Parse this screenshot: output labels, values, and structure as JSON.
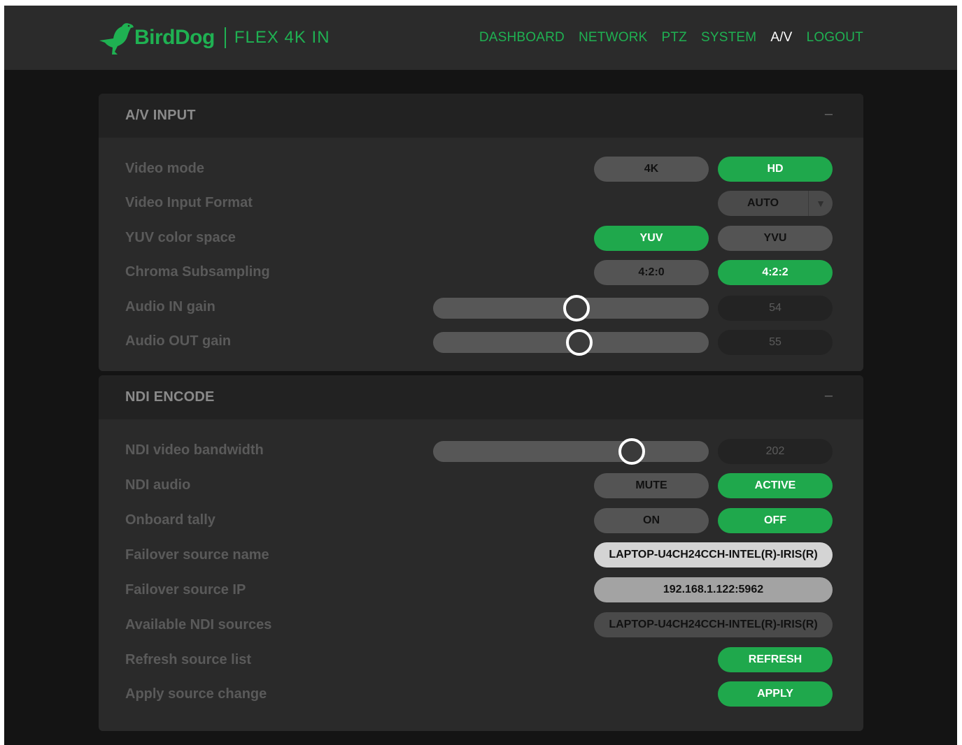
{
  "header": {
    "brand": "BirdDog",
    "product": "FLEX 4K IN",
    "nav": [
      {
        "label": "DASHBOARD",
        "active": false
      },
      {
        "label": "NETWORK",
        "active": false
      },
      {
        "label": "PTZ",
        "active": false
      },
      {
        "label": "SYSTEM",
        "active": false
      },
      {
        "label": "A/V",
        "active": true
      },
      {
        "label": "LOGOUT",
        "active": false
      }
    ]
  },
  "av_input": {
    "title": "A/V INPUT",
    "collapse": "–",
    "video_mode": {
      "label": "Video mode",
      "options": [
        "4K",
        "HD"
      ],
      "selected": "HD"
    },
    "video_input_format": {
      "label": "Video Input Format",
      "value": "AUTO"
    },
    "yuv_color_space": {
      "label": "YUV color space",
      "options": [
        "YUV",
        "YVU"
      ],
      "selected": "YUV"
    },
    "chroma_subsampling": {
      "label": "Chroma Subsampling",
      "options": [
        "4:2:0",
        "4:2:2"
      ],
      "selected": "4:2:2"
    },
    "audio_in_gain": {
      "label": "Audio IN gain",
      "value": "54",
      "level": 0.52
    },
    "audio_out_gain": {
      "label": "Audio OUT gain",
      "value": "55",
      "level": 0.53
    }
  },
  "ndi_encode": {
    "title": "NDI ENCODE",
    "collapse": "–",
    "ndi_video_bandwidth": {
      "label": "NDI video bandwidth",
      "value": "202",
      "level": 0.72
    },
    "ndi_audio": {
      "label": "NDI audio",
      "options": [
        "MUTE",
        "ACTIVE"
      ],
      "selected": "ACTIVE"
    },
    "onboard_tally": {
      "label": "Onboard tally",
      "options": [
        "ON",
        "OFF"
      ],
      "selected": "OFF"
    },
    "failover_source_name": {
      "label": "Failover source name",
      "value": "LAPTOP-U4CH24CCH-INTEL(R)-IRIS(R)"
    },
    "failover_source_ip": {
      "label": "Failover source IP",
      "value": "192.168.1.122:5962"
    },
    "available_ndi_sources": {
      "label": "Available NDI sources",
      "value": "LAPTOP-U4CH24CCH-INTEL(R)-IRIS(R)"
    },
    "refresh_source_list": {
      "label": "Refresh source list",
      "button": "REFRESH"
    },
    "apply_source_change": {
      "label": "Apply source change",
      "button": "APPLY"
    }
  },
  "colors": {
    "accent": "#1fa84c",
    "nav_green": "#1fb152"
  }
}
